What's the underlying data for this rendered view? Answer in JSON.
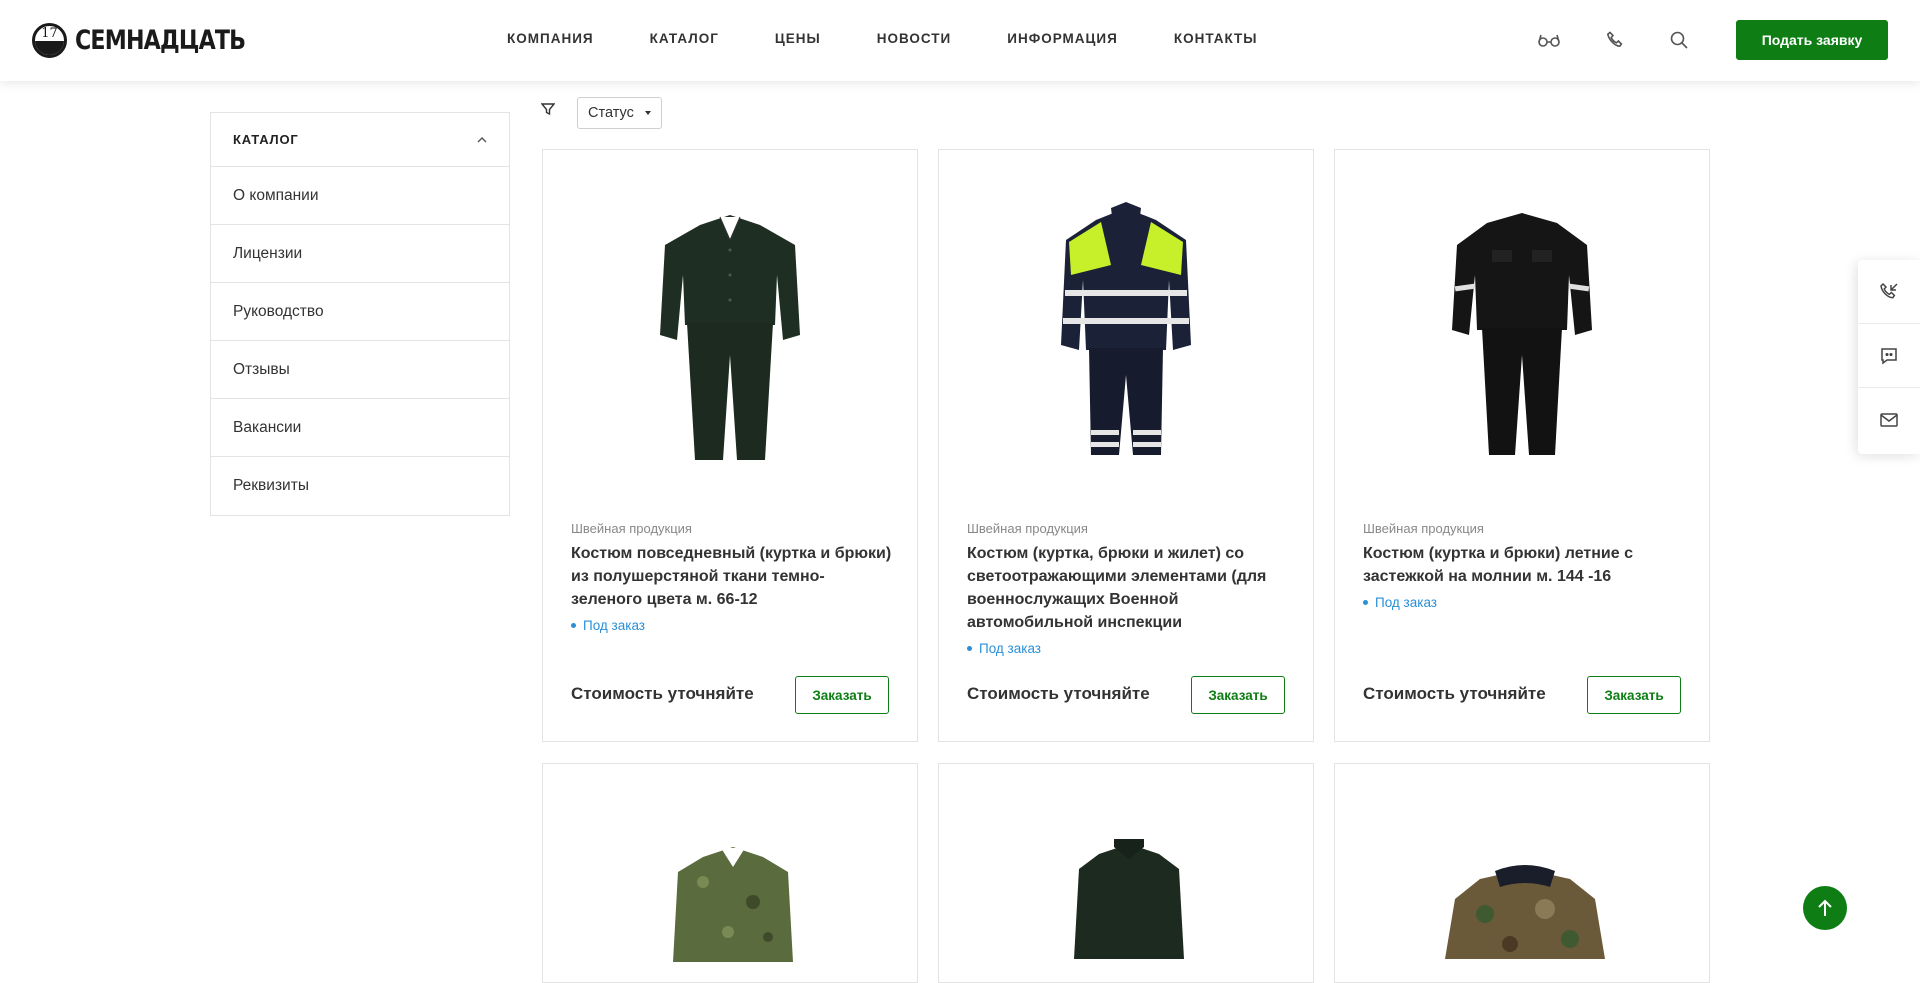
{
  "header": {
    "logo_number": "17",
    "logo_text": "СЕМНАДЦАТЬ",
    "nav": [
      "КОМПАНИЯ",
      "КАТАЛОГ",
      "ЦЕНЫ",
      "НОВОСТИ",
      "ИНФОРМАЦИЯ",
      "КОНТАКТЫ"
    ],
    "icons": [
      "glasses-icon",
      "phone-icon",
      "search-icon"
    ],
    "request_button": "Подать заявку"
  },
  "sidebar": {
    "title": "КАТАЛОГ",
    "items": [
      "О компании",
      "Лицензии",
      "Руководство",
      "Отзывы",
      "Вакансии",
      "Реквизиты"
    ]
  },
  "filter": {
    "status_label": "Статус"
  },
  "products": [
    {
      "category": "Швейная продукция",
      "name": "Костюм повседневный (куртка и брюки) из полушерстяной ткани темно-зеленого цвета м. 66-12",
      "availability": "Под заказ",
      "price": "Стоимость уточняйте",
      "order_label": "Заказать",
      "image": "dark-green-suit"
    },
    {
      "category": "Швейная продукция",
      "name": "Костюм (куртка, брюки и жилет) со светоотражающими элементами (для военнослужащих Военной автомобильной инспекции Вооруженны…",
      "availability": "Под заказ",
      "price": "Стоимость уточняйте",
      "order_label": "Заказать",
      "image": "reflective-suit"
    },
    {
      "category": "Швейная продукция",
      "name": "Костюм (куртка и брюки) летние с застежкой на молнии м. 144 -16",
      "availability": "Под заказ",
      "price": "Стоимость уточняйте",
      "order_label": "Заказать",
      "image": "black-summer-suit"
    }
  ],
  "products_row2": [
    {
      "image": "camo-pixel-jacket"
    },
    {
      "image": "dark-green-jacket"
    },
    {
      "image": "camo-winter-jacket"
    }
  ],
  "side_widget": [
    "callback-icon",
    "chat-icon",
    "mail-icon"
  ],
  "colors": {
    "accent": "#0d7d14",
    "link": "#2b8fd6"
  }
}
